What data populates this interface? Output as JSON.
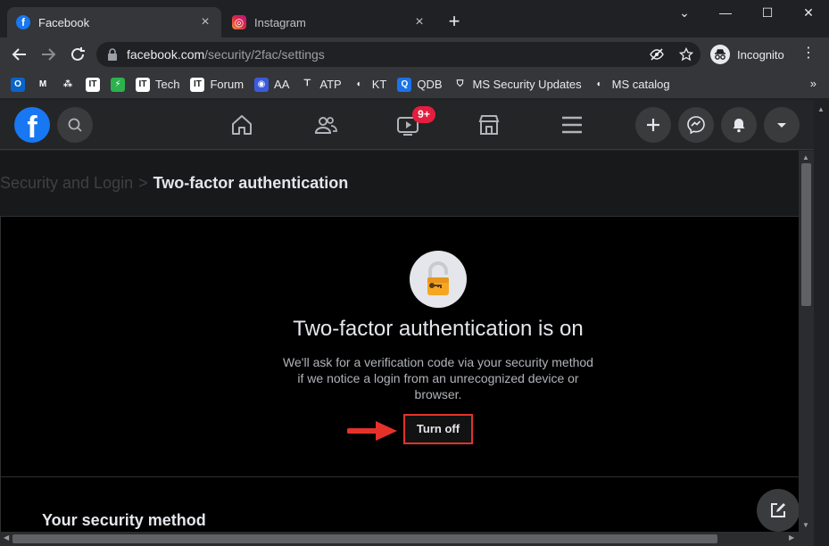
{
  "browser": {
    "tabs": [
      {
        "title": "Facebook",
        "favicon": "facebook-icon",
        "active": true
      },
      {
        "title": "Instagram",
        "favicon": "instagram-icon",
        "active": false
      }
    ],
    "new_tab": "+",
    "window_controls": {
      "dropdown": "⌄",
      "minimize": "—",
      "maximize": "☐",
      "close": "✕"
    },
    "address": {
      "host": "facebook.com",
      "path": "/security/2fac/settings"
    },
    "incognito_label": "Incognito",
    "menu": "⋮",
    "bookmarks": [
      {
        "label": "",
        "icon": "outlook-icon",
        "color": "#0a64c8",
        "glyph": "O"
      },
      {
        "label": "",
        "icon": "gmail-icon",
        "color": "#35363a",
        "glyph": "M"
      },
      {
        "label": "",
        "icon": "asana-icon",
        "color": "#35363a",
        "glyph": "⁂"
      },
      {
        "label": "",
        "icon": "itechtics-icon",
        "color": "#ffffff",
        "glyph": "IT"
      },
      {
        "label": "",
        "icon": "feedly-icon",
        "color": "#2bb24c",
        "glyph": "⚡"
      },
      {
        "label": "Tech",
        "icon": "itechtics-tech-icon",
        "color": "#ffffff",
        "glyph": "IT"
      },
      {
        "label": "Forum",
        "icon": "itechtics-forum-icon",
        "color": "#ffffff",
        "glyph": "IT"
      },
      {
        "label": "AA",
        "icon": "eye-icon",
        "color": "#3b5bdb",
        "glyph": "◉"
      },
      {
        "label": "ATP",
        "icon": "atp-icon",
        "color": "#35363a",
        "glyph": "𝍮"
      },
      {
        "label": "KT",
        "icon": "globe-icon",
        "color": "#35363a",
        "glyph": "◐"
      },
      {
        "label": "QDB",
        "icon": "qdb-icon",
        "color": "#1a73e8",
        "glyph": "Q"
      },
      {
        "label": "MS Security Updates",
        "icon": "shield-icon",
        "color": "#35363a",
        "glyph": "⛉"
      },
      {
        "label": "MS catalog",
        "icon": "globe-icon",
        "color": "#35363a",
        "glyph": "◐"
      }
    ],
    "bookmarks_more": "»"
  },
  "facebook": {
    "logo": "f",
    "notification_badge": "9+"
  },
  "page": {
    "breadcrumb_parent": "Security and Login",
    "breadcrumb_separator": ">",
    "breadcrumb_current": "Two-factor authentication",
    "status_title": "Two-factor authentication is on",
    "status_description": "We'll ask for a verification code via your security method if we notice a login from an unrecognized device or browser.",
    "turn_off_label": "Turn off",
    "section_title": "Your security method"
  },
  "colors": {
    "facebook_blue": "#1877f2",
    "highlight_red": "#e4322b",
    "badge_red": "#e41e3f"
  }
}
